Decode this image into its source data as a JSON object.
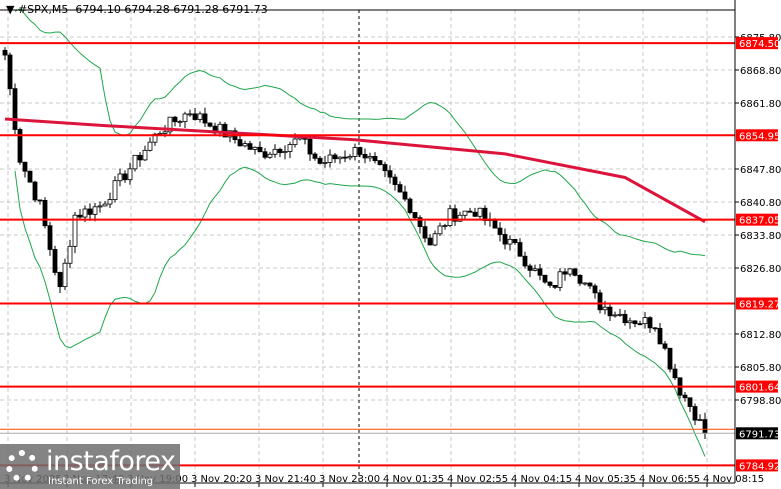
{
  "header": {
    "symbol": "#SPX,M5",
    "ohlc": "6794.10 6794.28 6791.28 6791.73"
  },
  "logo": {
    "brand": "instaforex",
    "tagline": "Instant Forex Trading"
  },
  "chart_data": {
    "type": "candlestick",
    "symbol": "#SPX",
    "timeframe": "M5",
    "ylim": [
      6783,
      6878
    ],
    "price_ticks": [
      "6875.80",
      "6868.80",
      "6861.80",
      "6847.80",
      "6840.80",
      "6833.80",
      "6826.80",
      "6812.80",
      "6805.80",
      "6798.80"
    ],
    "time_ticks": [
      "3 Nov 2025",
      "3 Nov 17:40",
      "3 Nov 19:00",
      "3 Nov 20:20",
      "3 Nov 21:40",
      "3 Nov 23:00",
      "4 Nov 01:35",
      "4 Nov 02:55",
      "4 Nov 04:15",
      "4 Nov 05:35",
      "4 Nov 06:55",
      "4 Nov 08:15"
    ],
    "levels": [
      {
        "label": "6874.50",
        "value": 6874.5
      },
      {
        "label": "6854.95",
        "value": 6854.95
      },
      {
        "label": "6837.05",
        "value": 6837.05
      },
      {
        "label": "6819.27",
        "value": 6819.27
      },
      {
        "label": "6801.64",
        "value": 6801.64
      },
      {
        "label": "6784.92",
        "value": 6784.92
      }
    ],
    "current_price": {
      "label": "6791.73",
      "value": 6791.73
    },
    "close_keypoints": [
      [
        0,
        6872
      ],
      [
        3,
        6850
      ],
      [
        7,
        6840
      ],
      [
        11,
        6822
      ],
      [
        14,
        6838
      ],
      [
        19,
        6840
      ],
      [
        25,
        6848
      ],
      [
        31,
        6856
      ],
      [
        37,
        6860
      ],
      [
        43,
        6856
      ],
      [
        51,
        6851
      ],
      [
        59,
        6854
      ],
      [
        63,
        6849
      ],
      [
        71,
        6852
      ],
      [
        77,
        6845
      ],
      [
        81,
        6840
      ],
      [
        85,
        6832
      ],
      [
        89,
        6838
      ],
      [
        94,
        6839
      ],
      [
        99,
        6834
      ],
      [
        103,
        6830
      ],
      [
        109,
        6822
      ],
      [
        113,
        6828
      ],
      [
        119,
        6819
      ],
      [
        125,
        6816
      ],
      [
        130,
        6815
      ],
      [
        135,
        6801
      ],
      [
        138,
        6796
      ],
      [
        140,
        6791.73
      ]
    ],
    "ma_keypoints": [
      [
        0,
        6858.4
      ],
      [
        20,
        6857
      ],
      [
        70,
        6854
      ],
      [
        100,
        6851
      ],
      [
        124,
        6846
      ],
      [
        140,
        6836.6
      ]
    ],
    "colors": {
      "level": "#ff0000",
      "ma": "#dc143c",
      "bands": "#1fa64a",
      "candle": "#000000",
      "current": "#ff4500"
    }
  }
}
